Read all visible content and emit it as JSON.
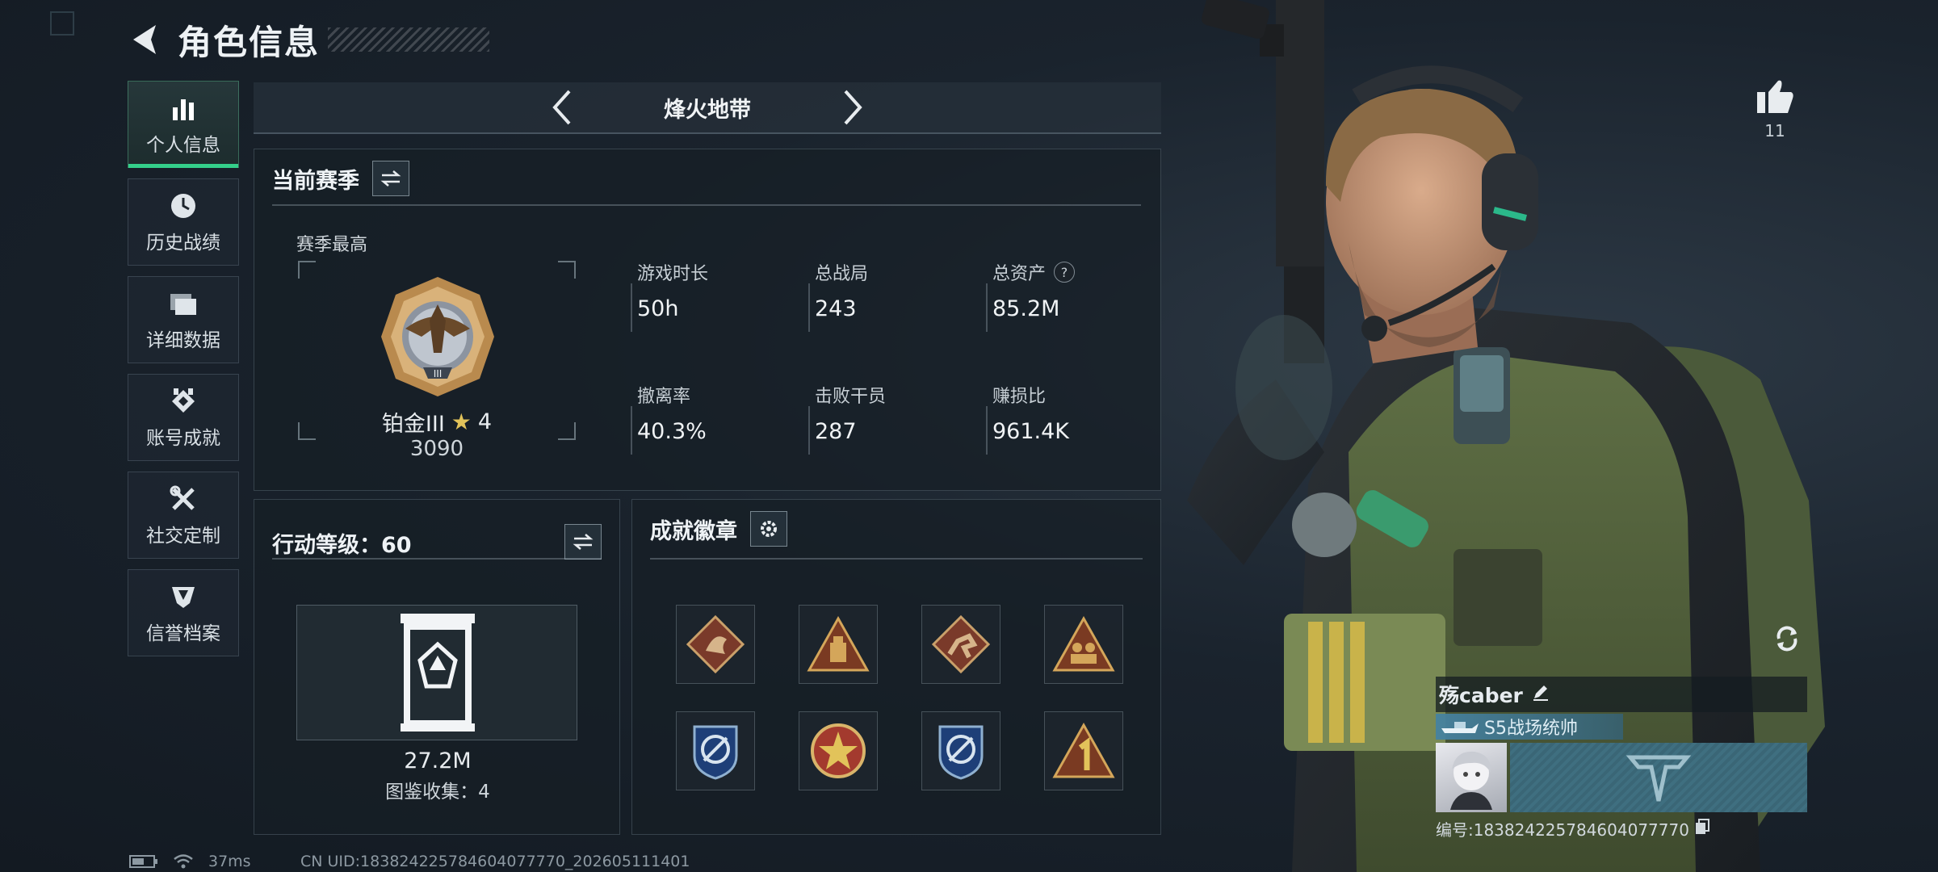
{
  "header": {
    "title": "角色信息"
  },
  "nav": {
    "items": [
      {
        "label": "个人信息",
        "icon": "bar-chart-icon",
        "active": true
      },
      {
        "label": "历史战绩",
        "icon": "clock-icon"
      },
      {
        "label": "详细数据",
        "icon": "folder-icon"
      },
      {
        "label": "账号成就",
        "icon": "achievement-icon"
      },
      {
        "label": "社交定制",
        "icon": "tools-icon"
      },
      {
        "label": "信誉档案",
        "icon": "shield-icon"
      }
    ]
  },
  "mode": {
    "title": "烽火地带"
  },
  "season": {
    "title": "当前赛季",
    "best_label": "赛季最高",
    "rank_name": "铂金III",
    "rank_stars": "4",
    "rank_score": "3090",
    "stats": [
      {
        "label": "游戏时长",
        "value": "50h"
      },
      {
        "label": "总战局",
        "value": "243"
      },
      {
        "label": "总资产",
        "value": "85.2M",
        "help": "?"
      },
      {
        "label": "撤离率",
        "value": "40.3%"
      },
      {
        "label": "击败干员",
        "value": "287"
      },
      {
        "label": "赚损比",
        "value": "961.4K"
      }
    ]
  },
  "action": {
    "title": "行动等级：60",
    "value": "27.2M",
    "collection": "图鉴收集：4"
  },
  "achievements": {
    "title": "成就徽章",
    "badges": [
      "dragon-badge-icon",
      "supply-badge-icon",
      "runner-badge-icon",
      "squad-badge-icon",
      "wing-shield-badge-icon",
      "star-medal-badge-icon",
      "wing-shield-badge-icon",
      "number-one-badge-icon"
    ]
  },
  "likes": {
    "count": "11"
  },
  "player": {
    "name": "殇caber",
    "title": "S5战场统帅",
    "id": "编号:1838242257846040777​70"
  },
  "footer": {
    "ping": "37ms",
    "uid": "CN UID:1838242257846040777​70_202605111401"
  },
  "colors": {
    "accent_green": "#34d08a",
    "gold": "#e2c35a",
    "banner_blue": "#4682a0"
  }
}
